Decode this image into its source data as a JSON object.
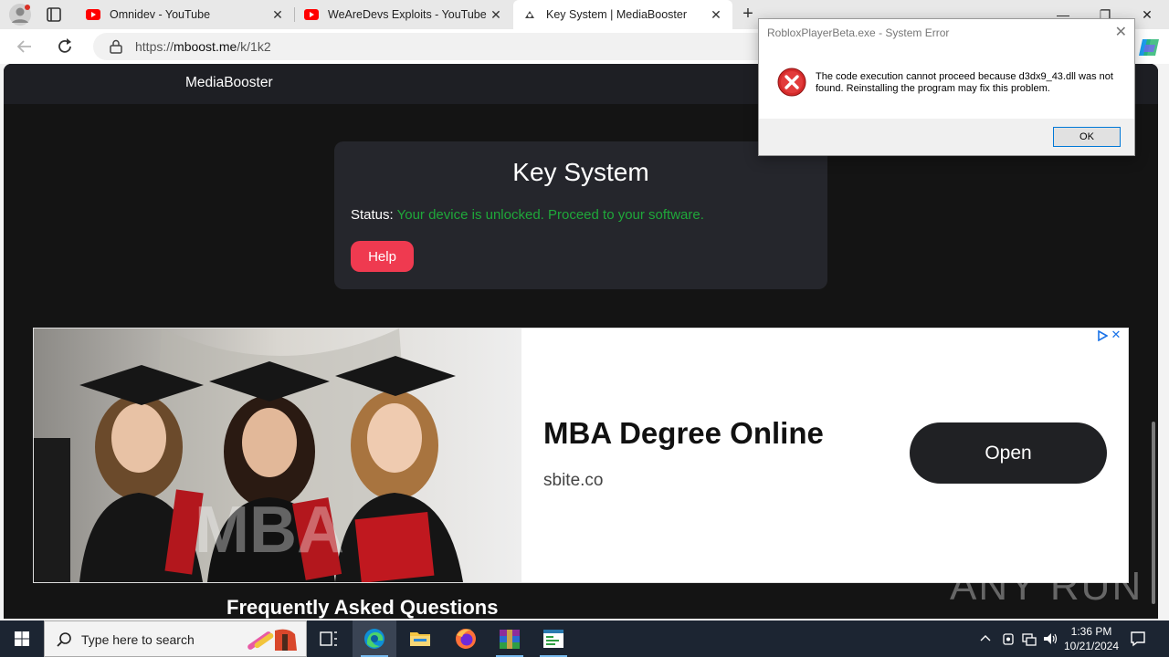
{
  "browser": {
    "tabs": [
      {
        "title": "Omnidev - YouTube",
        "favicon": "youtube-icon"
      },
      {
        "title": "WeAreDevs Exploits - YouTube",
        "favicon": "youtube-icon"
      },
      {
        "title": "Key System | MediaBooster",
        "favicon": "site-favicon-icon",
        "active": true
      }
    ],
    "url_prefix": "https://",
    "url_host": "mboost.me",
    "url_path": "/k/1k2"
  },
  "site": {
    "brand": "MediaBooster",
    "key_title": "Key System",
    "status_label": "Status:",
    "status_value": "Your device is unlocked. Proceed to your software.",
    "status_color": "#1fa83a",
    "help_label": "Help",
    "help_color": "#ef3a50",
    "faq_title": "Frequently Asked Questions"
  },
  "ad": {
    "image_text": "MBA",
    "headline": "MBA Degree Online",
    "domain": "sbite.co",
    "cta": "Open",
    "close": "✕"
  },
  "dialog": {
    "title": "RobloxPlayerBeta.exe - System Error",
    "message": "The code execution cannot proceed because d3dx9_43.dll was not found. Reinstalling the program may fix this problem.",
    "ok_label": "OK",
    "close": "✕"
  },
  "watermark": "ANY RUN",
  "taskbar": {
    "search_placeholder": "Type here to search",
    "time": "1:36 PM",
    "date": "10/21/2024"
  }
}
